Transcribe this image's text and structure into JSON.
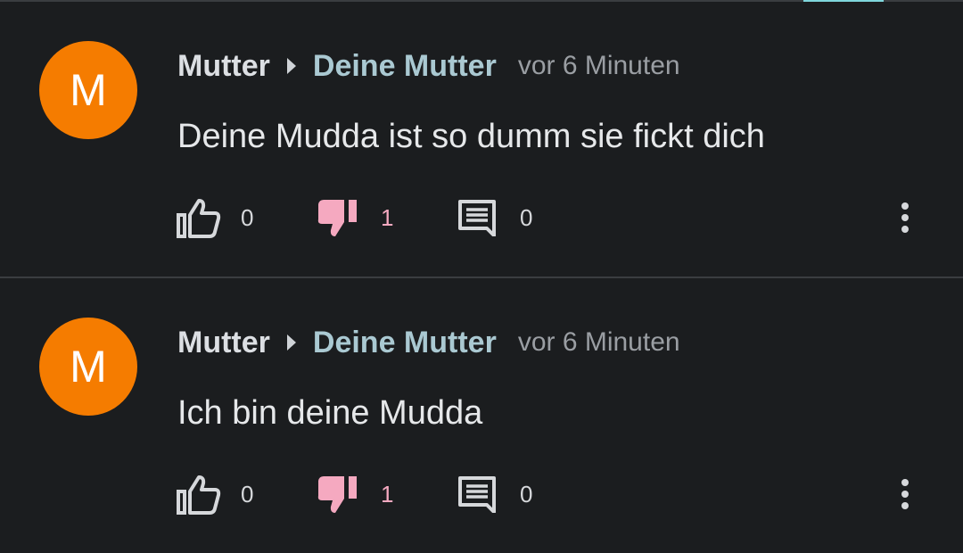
{
  "comments": [
    {
      "avatar_letter": "M",
      "author": "Mutter",
      "reply_to": "Deine Mutter",
      "time": "vor 6 Minuten",
      "text": "Deine Mudda ist so dumm sie fickt dich",
      "likes": "0",
      "dislikes": "1",
      "replies": "0"
    },
    {
      "avatar_letter": "M",
      "author": "Mutter",
      "reply_to": "Deine Mutter",
      "time": "vor 6 Minuten",
      "text": "Ich bin deine Mudda",
      "likes": "0",
      "dislikes": "1",
      "replies": "0"
    }
  ],
  "icons": {
    "like": "thumbs-up-outline-icon",
    "dislike": "thumbs-down-filled-icon",
    "reply": "comment-icon",
    "more": "more-vertical-icon",
    "reply_arrow": "caret-right-icon"
  },
  "colors": {
    "background": "#1b1d1f",
    "avatar": "#f57c00",
    "reply_to": "#aac9d2",
    "dislike_active": "#f5a9c0",
    "accent": "#7fd6dc"
  }
}
